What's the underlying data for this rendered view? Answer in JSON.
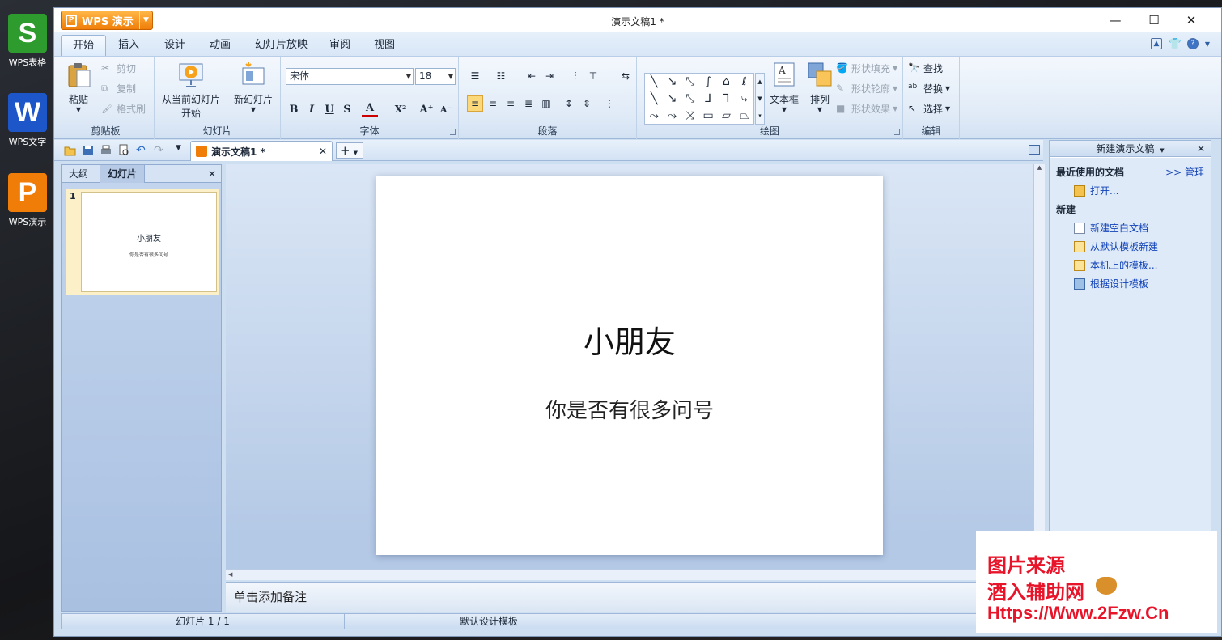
{
  "desktop": {
    "icons": [
      {
        "letter": "S",
        "label": "WPS表格",
        "color": "#2e9b2e"
      },
      {
        "letter": "W",
        "label": "WPS文字",
        "color": "#1d56c9"
      },
      {
        "letter": "P",
        "label": "WPS演示",
        "color": "#f07d08"
      }
    ]
  },
  "window": {
    "app_button": "WPS 演示",
    "title": "演示文稿1 *",
    "controls": [
      "—",
      "☐",
      "✕"
    ]
  },
  "ribbon_tabs": [
    "开始",
    "插入",
    "设计",
    "动画",
    "幻灯片放映",
    "审阅",
    "视图"
  ],
  "ribbon": {
    "clipboard": {
      "paste": "粘贴",
      "cut": "剪切",
      "copy": "复制",
      "format_painter": "格式刷",
      "label": "剪贴板"
    },
    "slides": {
      "from_current_1": "从当前幻灯片",
      "from_current_2": "开始",
      "new_slide": "新幻灯片",
      "label": "幻灯片"
    },
    "font": {
      "name": "宋体",
      "size": "18",
      "label": "字体",
      "bold": "B",
      "italic": "I",
      "underline": "U",
      "shadow": "S",
      "color": "A",
      "superscript": "X²",
      "grow": "A⁺",
      "shrink": "A⁻"
    },
    "paragraph": {
      "label": "段落"
    },
    "drawing": {
      "textbox": "文本框",
      "arrange": "排列",
      "fill": "形状填充",
      "outline": "形状轮廓",
      "effect": "形状效果",
      "label": "绘图"
    },
    "editing": {
      "find": "查找",
      "replace": "替换",
      "select": "选择",
      "label": "编辑"
    }
  },
  "doc_tab": {
    "title": "演示文稿1 *"
  },
  "left_pane": {
    "tabs": [
      "大纲",
      "幻灯片"
    ],
    "thumb_number": "1",
    "thumb_title": "小朋友",
    "thumb_subtitle": "你是否有很多问号"
  },
  "slide": {
    "title": "小朋友",
    "subtitle": "你是否有很多问号"
  },
  "notes": {
    "placeholder": "单击添加备注"
  },
  "status": {
    "slide_info": "幻灯片 1 / 1",
    "template": "默认设计模板"
  },
  "task_pane": {
    "title": "新建演示文稿",
    "recent_header": "最近使用的文档",
    "manage": ">> 管理",
    "open": "打开...",
    "new_header": "新建",
    "links": [
      "新建空白文档",
      "从默认模板新建",
      "本机上的模板...",
      "根据设计模板"
    ]
  },
  "watermark": {
    "line1": "图片来源",
    "line2": "酒入辅助网",
    "line3": "Https://Www.2Fzw.Cn"
  }
}
